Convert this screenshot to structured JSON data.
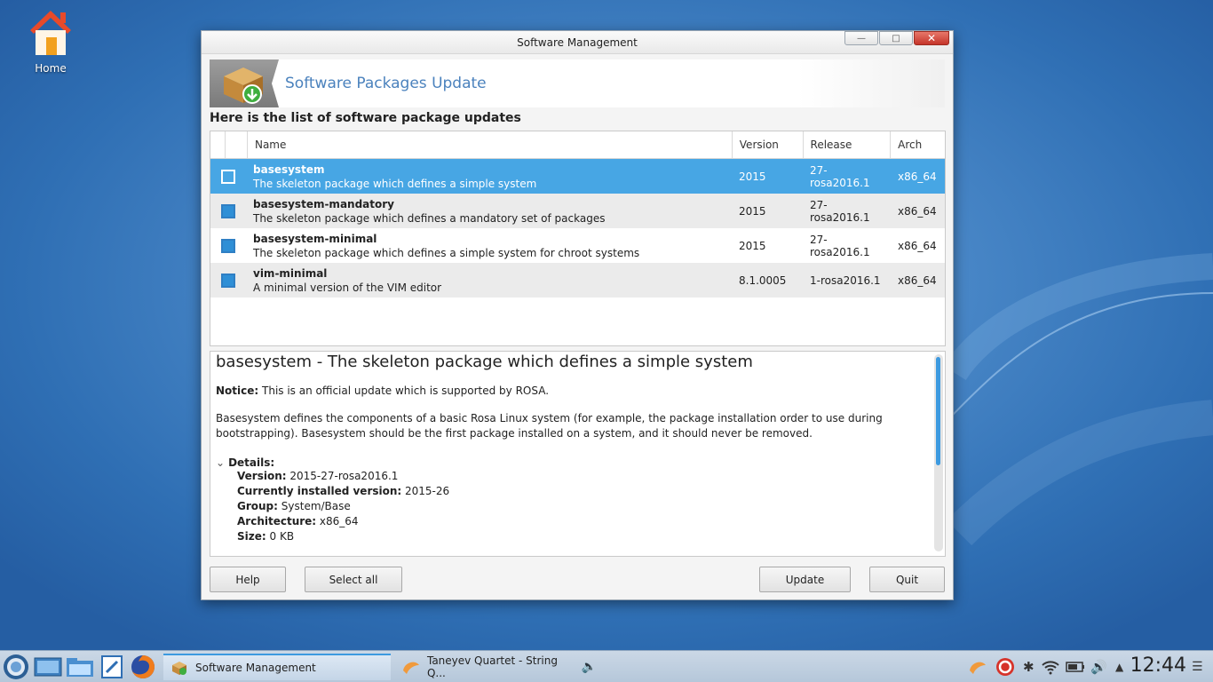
{
  "desktop": {
    "home_label": "Home"
  },
  "window": {
    "title": "Software Management",
    "banner_title": "Software Packages Update",
    "list_heading": "Here is the list of software package updates",
    "columns": [
      "Name",
      "Version",
      "Release",
      "Arch"
    ],
    "packages": [
      {
        "name": "basesystem",
        "description": "The skeleton package which defines a simple system",
        "version": "2015",
        "release": "27-rosa2016.1",
        "arch": "x86_64",
        "checked": false,
        "selected": true
      },
      {
        "name": "basesystem-mandatory",
        "description": "The skeleton package which defines a mandatory set of packages",
        "version": "2015",
        "release": "27-rosa2016.1",
        "arch": "x86_64",
        "checked": true,
        "selected": false
      },
      {
        "name": "basesystem-minimal",
        "description": "The skeleton package which defines a simple system for chroot systems",
        "version": "2015",
        "release": "27-rosa2016.1",
        "arch": "x86_64",
        "checked": true,
        "selected": false
      },
      {
        "name": "vim-minimal",
        "description": "A minimal version of the VIM editor",
        "version": "8.1.0005",
        "release": "1-rosa2016.1",
        "arch": "x86_64",
        "checked": true,
        "selected": false
      }
    ],
    "details": {
      "title": "basesystem - The skeleton package which defines a simple system",
      "notice_label": "Notice:",
      "notice_text": " This is an official update which is supported by ROSA.",
      "description": "Basesystem defines the components of a basic Rosa Linux system (for example, the package installation order to use during bootstrapping). Basesystem should be the first package installed on a system, and it should never be removed.",
      "details_label": "Details:",
      "fields": [
        {
          "label": "Version:",
          "value": " 2015-27-rosa2016.1"
        },
        {
          "label": "Currently installed version:",
          "value": " 2015-26"
        },
        {
          "label": "Group:",
          "value": " System/Base"
        },
        {
          "label": "Architecture:",
          "value": " x86_64"
        },
        {
          "label": "Size:",
          "value": " 0 KB"
        }
      ]
    },
    "buttons": {
      "help": "Help",
      "select_all": "Select all",
      "update": "Update",
      "quit": "Quit"
    }
  },
  "taskbar": {
    "tasks": [
      {
        "label": "Software Management",
        "active": true
      },
      {
        "label": "Taneyev Quartet - String Q...",
        "active": false
      }
    ],
    "clock": "12:44"
  },
  "colors": {
    "accent": "#47a6e4",
    "banner_title": "#4b82bd",
    "close_button": "#c5352a"
  }
}
